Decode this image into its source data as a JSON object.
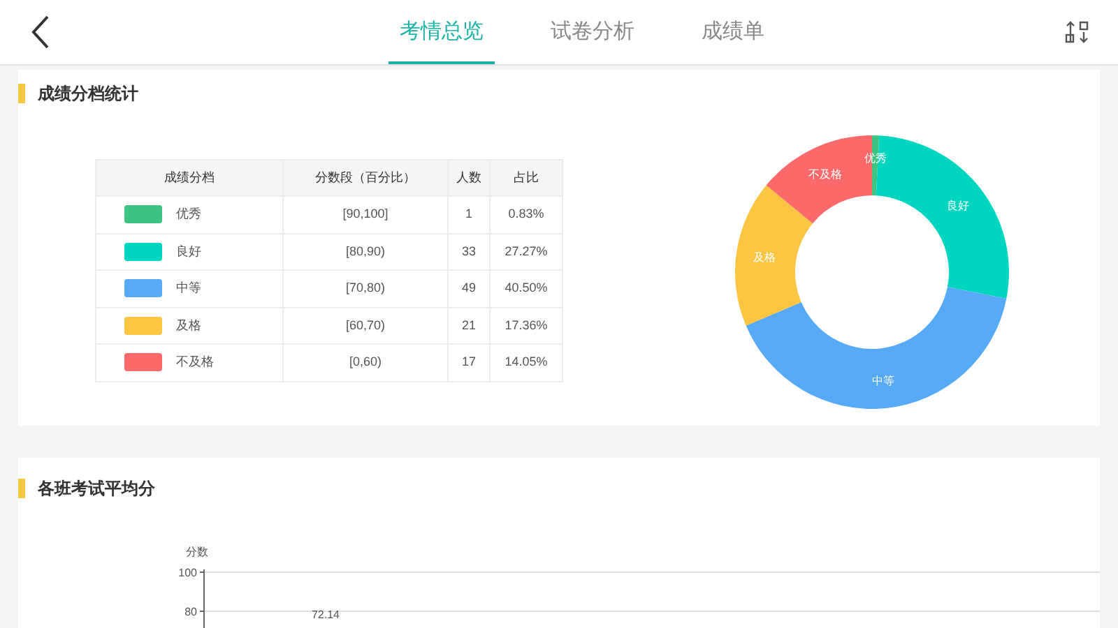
{
  "tabs": [
    {
      "label": "考情总览",
      "selected": true
    },
    {
      "label": "试卷分析",
      "selected": false
    },
    {
      "label": "成绩单",
      "selected": false
    }
  ],
  "grade_section": {
    "title": "成绩分档统计",
    "table": {
      "columns": [
        "成绩分档",
        "分数段（百分比）",
        "人数",
        "占比"
      ],
      "rows": [
        {
          "color": "#3cc480",
          "grade": "优秀",
          "range": "[90,100]",
          "count": "1",
          "share": "0.83%"
        },
        {
          "color": "#00d5c0",
          "grade": "良好",
          "range": "[80,90)",
          "count": "33",
          "share": "27.27%"
        },
        {
          "color": "#55a9f7",
          "grade": "中等",
          "range": "[70,80)",
          "count": "49",
          "share": "40.50%"
        },
        {
          "color": "#fbc541",
          "grade": "及格",
          "range": "[60,70)",
          "count": "21",
          "share": "17.36%"
        },
        {
          "color": "#fb6a6a",
          "grade": "不及格",
          "range": "[0,60)",
          "count": "17",
          "share": "14.05%"
        }
      ]
    },
    "chart_data": {
      "type": "donut",
      "categories": [
        "优秀",
        "良好",
        "中等",
        "及格",
        "不及格"
      ],
      "values": [
        0.83,
        27.27,
        40.5,
        17.36,
        14.05
      ]
    }
  },
  "class_section": {
    "title": "各班考试平均分",
    "axis_title": "分数",
    "tick_labels": [
      "100",
      "80"
    ],
    "bar_label": "72.14"
  }
}
